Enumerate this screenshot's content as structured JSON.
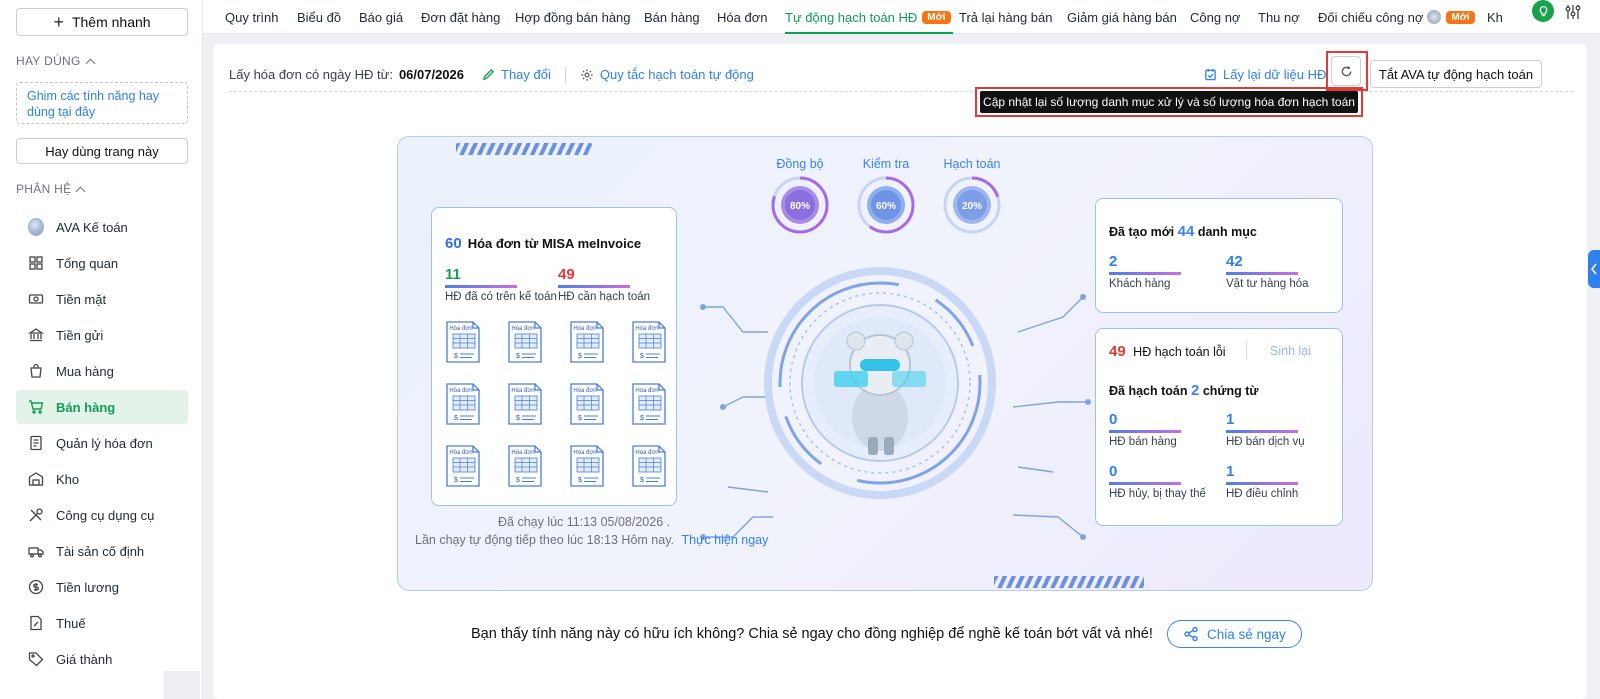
{
  "sidebar": {
    "quick_add_label": "Thêm nhanh",
    "favorites_header": "HAY DÙNG",
    "pin_hint": "Ghim các tính năng hay dùng tại đây",
    "use_page_label": "Hay dùng trang này",
    "modules_header": "PHÂN HỆ",
    "items": [
      {
        "label": "AVA Kế toán",
        "icon": "ava-avatar-icon"
      },
      {
        "label": "Tổng quan",
        "icon": "dashboard-icon"
      },
      {
        "label": "Tiền mặt",
        "icon": "cash-icon"
      },
      {
        "label": "Tiền gửi",
        "icon": "bank-icon"
      },
      {
        "label": "Mua hàng",
        "icon": "shopping-bag-icon"
      },
      {
        "label": "Bán hàng",
        "icon": "cart-icon",
        "active": true
      },
      {
        "label": "Quản lý hóa đơn",
        "icon": "invoice-icon"
      },
      {
        "label": "Kho",
        "icon": "warehouse-icon"
      },
      {
        "label": "Công cụ dụng cụ",
        "icon": "tools-icon"
      },
      {
        "label": "Tài sản cố định",
        "icon": "truck-icon"
      },
      {
        "label": "Tiền lương",
        "icon": "salary-icon"
      },
      {
        "label": "Thuế",
        "icon": "tax-icon"
      },
      {
        "label": "Giá thành",
        "icon": "price-tag-icon"
      }
    ]
  },
  "topnav": {
    "tabs": [
      "Quy trình",
      "Biểu đồ",
      "Báo giá",
      "Đơn đặt hàng",
      "Hợp đồng bán hàng",
      "Bán hàng",
      "Hóa đơn",
      "Tự động hạch toán HĐ",
      "Trả lại hàng bán",
      "Giảm giá hàng bán",
      "Công nợ",
      "Thu nợ",
      "Đối chiếu công nợ",
      "Kh"
    ],
    "active_tab": "Tự động hạch toán HĐ",
    "new_badge": "Mới"
  },
  "toolbar": {
    "date_label": "Lấy hóa đơn có ngày HĐ từ:",
    "date_value": "06/07/2026",
    "change_label": "Thay đổi",
    "rules_label": "Quy tắc hạch toán tự động",
    "reload_label": "Lấy lại dữ liệu HĐ",
    "turn_off_label": "Tắt AVA tự động hạch toán",
    "tooltip": "Cập nhật lại số lượng danh mục xử lý và số lượng hóa đơn hạch toán"
  },
  "dashboard": {
    "invoices": {
      "count": "60",
      "title": "Hóa đơn từ MISA meInvoice",
      "existing_count": "11",
      "existing_label": "HĐ đã có trên kế toán",
      "pending_count": "49",
      "pending_label": "HĐ cần hạch toán",
      "invoice_icon_text": "Hóa đơn"
    },
    "gauges": [
      {
        "label": "Đồng bộ",
        "value": "80%"
      },
      {
        "label": "Kiểm tra",
        "value": "60%"
      },
      {
        "label": "Hạch toán",
        "value": "20%"
      }
    ],
    "catalog": {
      "prefix": "Đã tạo mới",
      "count": "44",
      "suffix": "danh mục",
      "customers_count": "2",
      "customers_label": "Khách hàng",
      "goods_count": "42",
      "goods_label": "Vật tư hàng hóa"
    },
    "posting": {
      "error_count": "49",
      "error_label": "HĐ hạch toán lỗi",
      "regenerate_label": "Sinh lại",
      "posted_prefix": "Đã hạch toán",
      "posted_count": "2",
      "posted_suffix": "chứng từ",
      "sales_count": "0",
      "sales_label": "HĐ bán hàng",
      "service_count": "1",
      "service_label": "HĐ bán dịch vụ",
      "cancel_count": "0",
      "cancel_label": "HĐ hủy, bị thay thế",
      "adjust_count": "1",
      "adjust_label": "HĐ điều chỉnh"
    },
    "last_run": "Đã chạy lúc 11:13 05/08/2026 .",
    "next_run": "Lần chạy tự động tiếp theo lúc 18:13 Hôm nay.",
    "run_now_label": "Thực hiện ngay"
  },
  "feedback": {
    "question": "Bạn thấy tính năng này có hữu ích không? Chia sẻ ngay cho đồng nghiệp để nghề kế toán bớt vất vả nhé!",
    "share_label": "Chia sẻ ngay"
  },
  "colors": {
    "accent": "#0f9d58",
    "link": "#2f80ed",
    "danger": "#e53935",
    "new_badge": "#f97316"
  }
}
